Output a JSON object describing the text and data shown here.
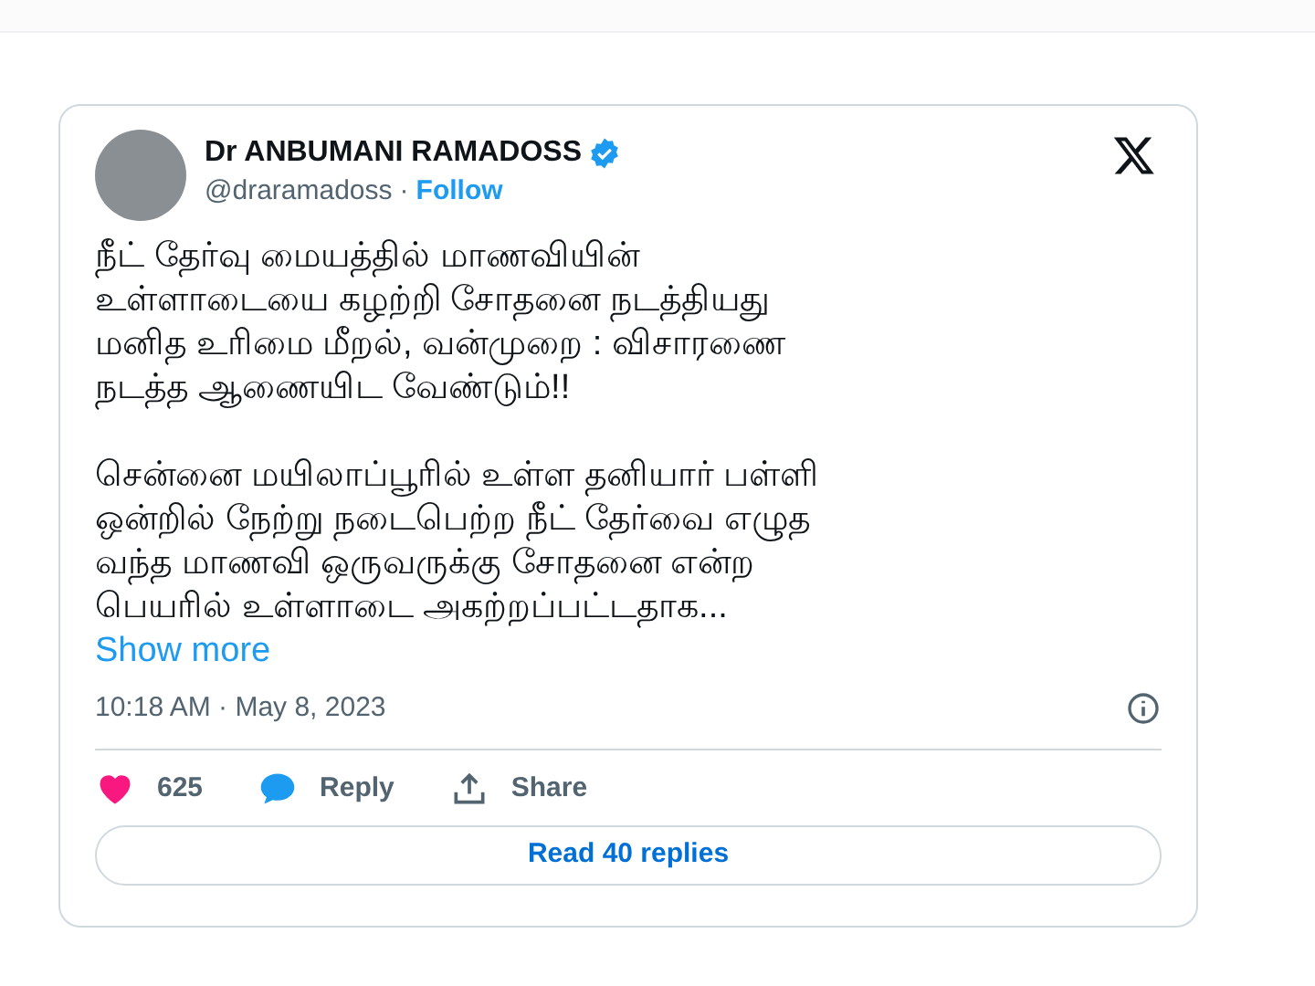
{
  "author": {
    "name": "Dr ANBUMANI RAMADOSS",
    "verified": true,
    "handle": "@draramadoss",
    "separator": "·",
    "follow": "Follow"
  },
  "paragraphs": [
    {
      "lines": [
        "நீட் தேர்வு மையத்தில் மாணவியின்",
        "உள்ளாடையை கழற்றி சோதனை நடத்தியது",
        "மனித உரிமை மீறல், வன்முறை : விசாரணை",
        "நடத்த ஆணையிட வேண்டும்!!"
      ]
    },
    {
      "lines": [
        "சென்னை மயிலாப்பூரில் உள்ள தனியார் பள்ளி",
        "ஒன்றில் நேற்று நடைபெற்ற நீட் தேர்வை எழுத",
        "வந்த மாணவி ஒருவருக்கு சோதனை என்ற",
        "பெயரில்  உள்ளாடை அகற்றப்பட்டதாக..."
      ]
    }
  ],
  "show_more": "Show more",
  "timestamp": "10:18 AM · May 8, 2023",
  "actions": [
    {
      "kind": "like",
      "label": "625"
    },
    {
      "kind": "reply",
      "label": "Reply"
    },
    {
      "kind": "share",
      "label": "Share"
    }
  ],
  "read_replies": "Read 40 replies"
}
